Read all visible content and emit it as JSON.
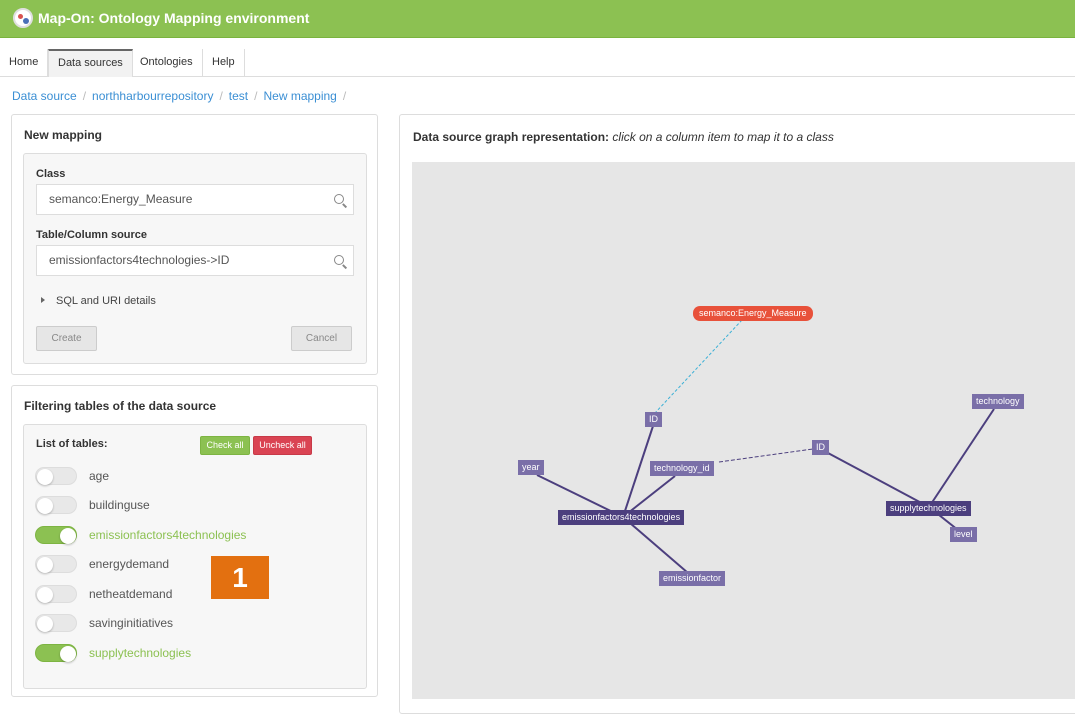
{
  "app": {
    "title": "Map-On: Ontology Mapping environment"
  },
  "nav": {
    "tabs": [
      "Home",
      "Data sources",
      "Ontologies",
      "Help"
    ],
    "active": "Data sources"
  },
  "breadcrumb": [
    "Data source",
    "northharbourrepository",
    "test",
    "New mapping"
  ],
  "new_mapping": {
    "title": "New mapping",
    "class_label": "Class",
    "class_value": "semanco:Energy_Measure",
    "source_label": "Table/Column source",
    "source_value": "emissionfactors4technologies->ID",
    "details_label": "SQL and URI details",
    "create_label": "Create",
    "cancel_label": "Cancel"
  },
  "filtering": {
    "title": "Filtering tables of the data source",
    "list_label": "List of tables:",
    "check_all": "Check all",
    "uncheck_all": "Uncheck all",
    "tables": [
      {
        "name": "age",
        "on": false
      },
      {
        "name": "buildinguse",
        "on": false
      },
      {
        "name": "emissionfactors4technologies",
        "on": true
      },
      {
        "name": "energydemand",
        "on": false
      },
      {
        "name": "netheatdemand",
        "on": false
      },
      {
        "name": "savinginitiatives",
        "on": false
      },
      {
        "name": "supplytechnologies",
        "on": true
      }
    ]
  },
  "badge": "1",
  "graph": {
    "title_bold": "Data source graph representation:",
    "title_italic": "click on a column item to map it to a class",
    "nodes": [
      {
        "label": "semanco:Energy_Measure",
        "kind": "class"
      },
      {
        "label": "ID",
        "kind": "column"
      },
      {
        "label": "year",
        "kind": "column"
      },
      {
        "label": "technology_id",
        "kind": "column"
      },
      {
        "label": "emissionfactors4technologies",
        "kind": "table"
      },
      {
        "label": "emissionfactor",
        "kind": "column"
      },
      {
        "label": "ID",
        "kind": "column"
      },
      {
        "label": "technology",
        "kind": "column"
      },
      {
        "label": "supplytechnologies",
        "kind": "table"
      },
      {
        "label": "level",
        "kind": "column"
      }
    ],
    "colors": {
      "table": "#4c3f7e",
      "column": "#7a6fa8",
      "class": "#e8513a",
      "edge": "#4c3f7e",
      "class_edge": "#3bb0d6"
    }
  }
}
